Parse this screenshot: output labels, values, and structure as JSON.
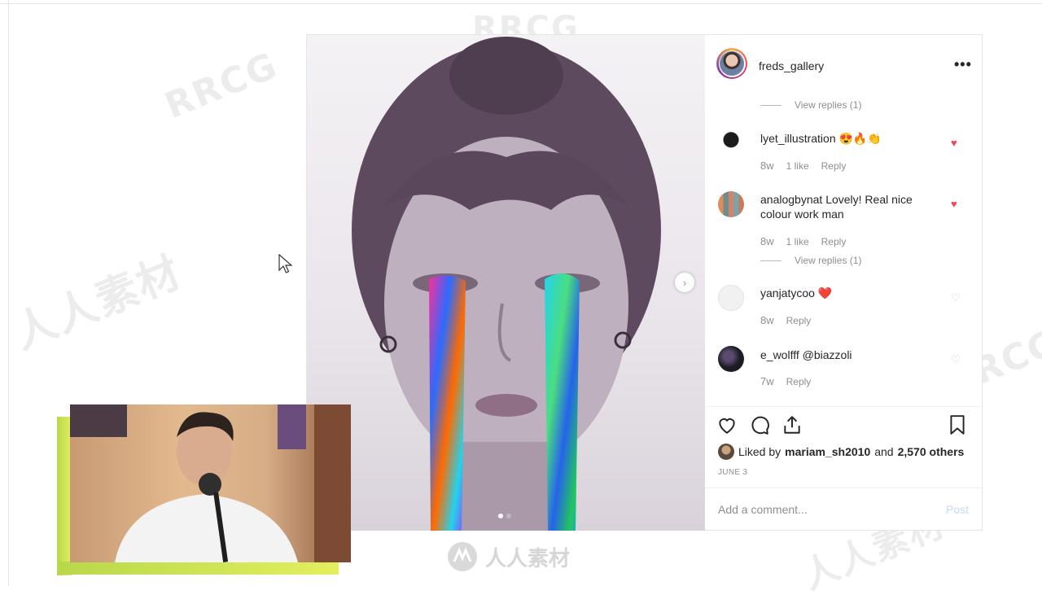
{
  "post": {
    "username": "freds_gallery",
    "more_label": "•••",
    "carousel_next": "›",
    "comments": [
      {
        "replies_label": "View replies (1)"
      },
      {
        "user": "lyet_illustration",
        "text": "😍🔥👏",
        "time": "8w",
        "likes": "1 like",
        "reply": "Reply",
        "liked": true
      },
      {
        "user": "analogbynat",
        "text": "Lovely! Real nice colour work man",
        "time": "8w",
        "likes": "1 like",
        "reply": "Reply",
        "liked": true,
        "replies_label": "View replies (1)"
      },
      {
        "user": "yanjatycoo",
        "text": "❤️",
        "time": "8w",
        "reply": "Reply",
        "liked": false
      },
      {
        "user": "e_wolfff",
        "text": "@biazzoli",
        "time": "7w",
        "reply": "Reply",
        "liked": false
      }
    ],
    "liked_by_prefix": "Liked by",
    "liked_by_user": "mariam_sh2010",
    "liked_by_and": "and",
    "liked_by_others": "2,570 others",
    "date": "JUNE 3",
    "comment_placeholder": "Add a comment...",
    "post_button": "Post"
  },
  "watermarks": {
    "rrcg": "RRCG",
    "cn": "人人素材"
  },
  "colors": {
    "heart_red": "#ed4956",
    "link_blue_disabled": "#c2dcf5"
  }
}
